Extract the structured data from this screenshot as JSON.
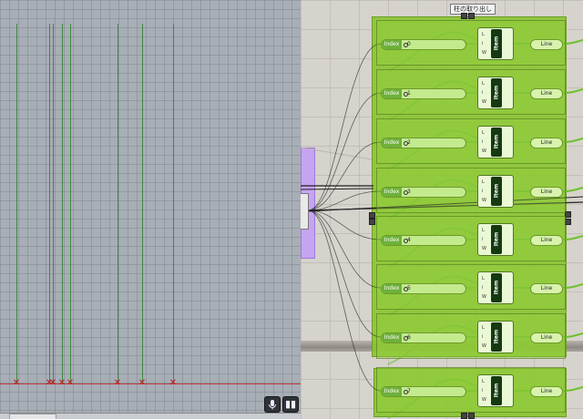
{
  "viewport": {
    "ctrl_mic_icon": "microphone-icon",
    "ctrl_pause_icon": "pause-icon",
    "pause_glyph": "▮▮"
  },
  "group": {
    "label": "柱の取り出し"
  },
  "rows": [
    {
      "slider_label": "Index",
      "slider_value": "0",
      "item_inputs": "L\ni\nW",
      "item_label": "Item",
      "line_label": "Line"
    },
    {
      "slider_label": "Index",
      "slider_value": "1",
      "item_inputs": "L\ni\nW",
      "item_label": "Item",
      "line_label": "Line"
    },
    {
      "slider_label": "Index",
      "slider_value": "2",
      "item_inputs": "L\ni\nW",
      "item_label": "Item",
      "line_label": "Line"
    },
    {
      "slider_label": "Index",
      "slider_value": "3",
      "item_inputs": "L\ni\nW",
      "item_label": "Item",
      "line_label": "Line"
    },
    {
      "slider_label": "Index",
      "slider_value": "4",
      "item_inputs": "L\ni\nW",
      "item_label": "Item",
      "line_label": "Line"
    },
    {
      "slider_label": "Index",
      "slider_value": "5",
      "item_inputs": "L\ni\nW",
      "item_label": "Item",
      "line_label": "Line"
    },
    {
      "slider_label": "Index",
      "slider_value": "6",
      "item_inputs": "L\ni\nW",
      "item_label": "Item",
      "line_label": "Line"
    },
    {
      "slider_label": "Index",
      "slider_value": "7",
      "item_inputs": "L\ni\nW",
      "item_label": "Item",
      "line_label": "Line"
    }
  ],
  "colors": {
    "group_fill": "#8ac430",
    "wire": "#6fbf2e",
    "column_line": "#3e8a3e",
    "ground_line": "#c23a3a",
    "purple_node": "#c6a4f2"
  }
}
